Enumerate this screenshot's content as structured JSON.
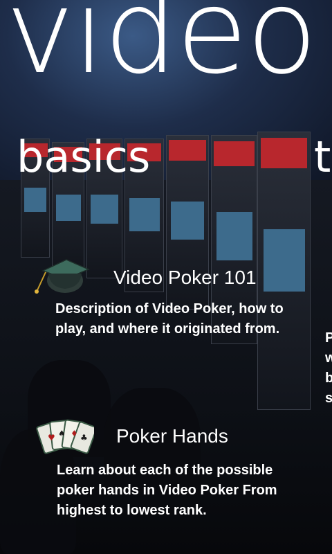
{
  "panorama": {
    "title": "video"
  },
  "pivot": {
    "current_header": "basics",
    "next_header_peek": "t"
  },
  "items": [
    {
      "title": "Video Poker 101",
      "description": "Description of Video Poker, how to play, and where it originated from.",
      "icon": "graduation-cap-icon"
    },
    {
      "title": "Poker Hands",
      "description": "Learn about each of the possible poker hands in Video Poker From highest to lowest rank.",
      "icon": "playing-cards-icon"
    }
  ],
  "peek_lines": [
    "P",
    "w",
    "b",
    "s"
  ],
  "colors": {
    "text": "#ffffff",
    "background": "#0b0e17"
  }
}
